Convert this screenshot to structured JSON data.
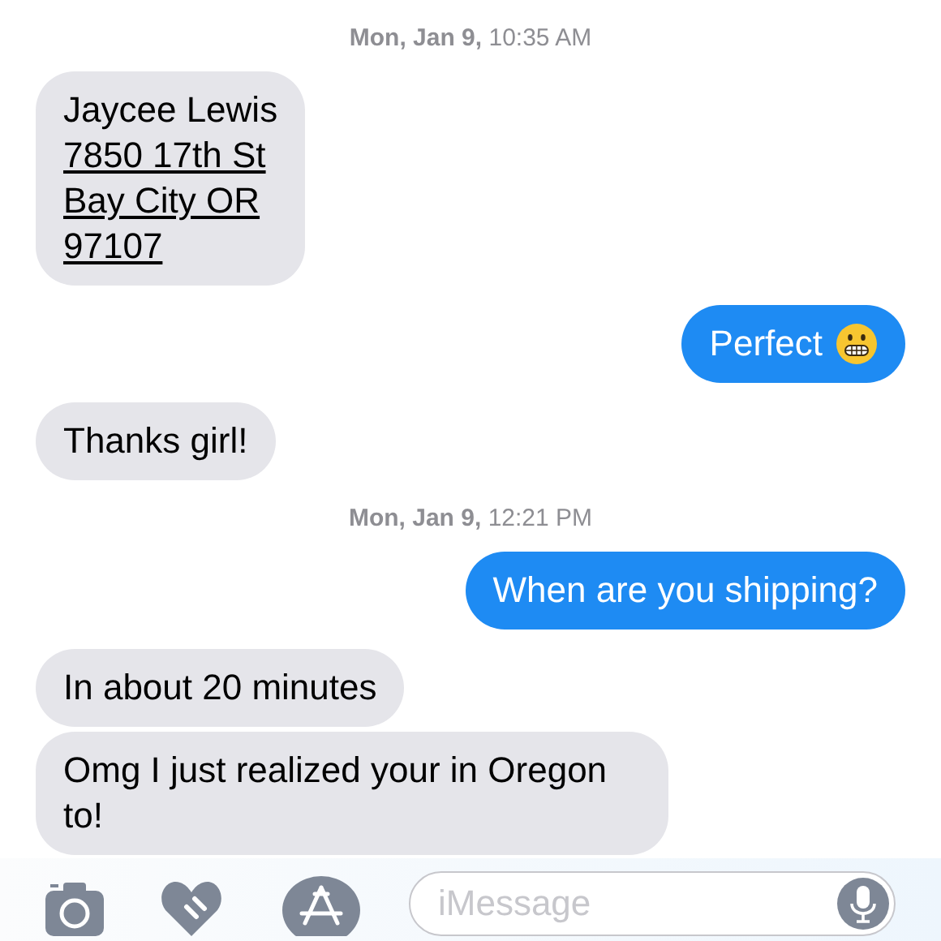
{
  "conversation": [
    {
      "kind": "timestamp",
      "text": "**Mon, Jan 9,** 10:35 AM"
    },
    {
      "kind": "incoming",
      "lines": [
        {
          "text": "Jaycee Lewis",
          "link": false
        },
        {
          "text": "7850 17th St",
          "link": true
        },
        {
          "text": "Bay City OR",
          "link": true
        },
        {
          "text": "97107",
          "link": true
        }
      ]
    },
    {
      "kind": "outgoing",
      "lines": [
        {
          "text": "Perfect",
          "link": false
        }
      ]
    },
    {
      "kind": "incoming",
      "lines": [
        {
          "text": "Thanks girl!",
          "link": false
        }
      ]
    },
    {
      "kind": "timestamp",
      "text": "**Mon, Jan 9,** 12:21 PM"
    },
    {
      "kind": "outgoing",
      "lines": [
        {
          "text": "When are you shipping?",
          "link": false
        }
      ]
    },
    {
      "kind": "incoming",
      "lines": [
        {
          "text": "In about 20 minutes",
          "link": false
        }
      ]
    },
    {
      "kind": "incoming",
      "lines": [
        {
          "text": "Omg I just realized your in Oregon to!",
          "link": false
        }
      ]
    }
  ],
  "compose": {
    "placeholder": "iMessage"
  }
}
